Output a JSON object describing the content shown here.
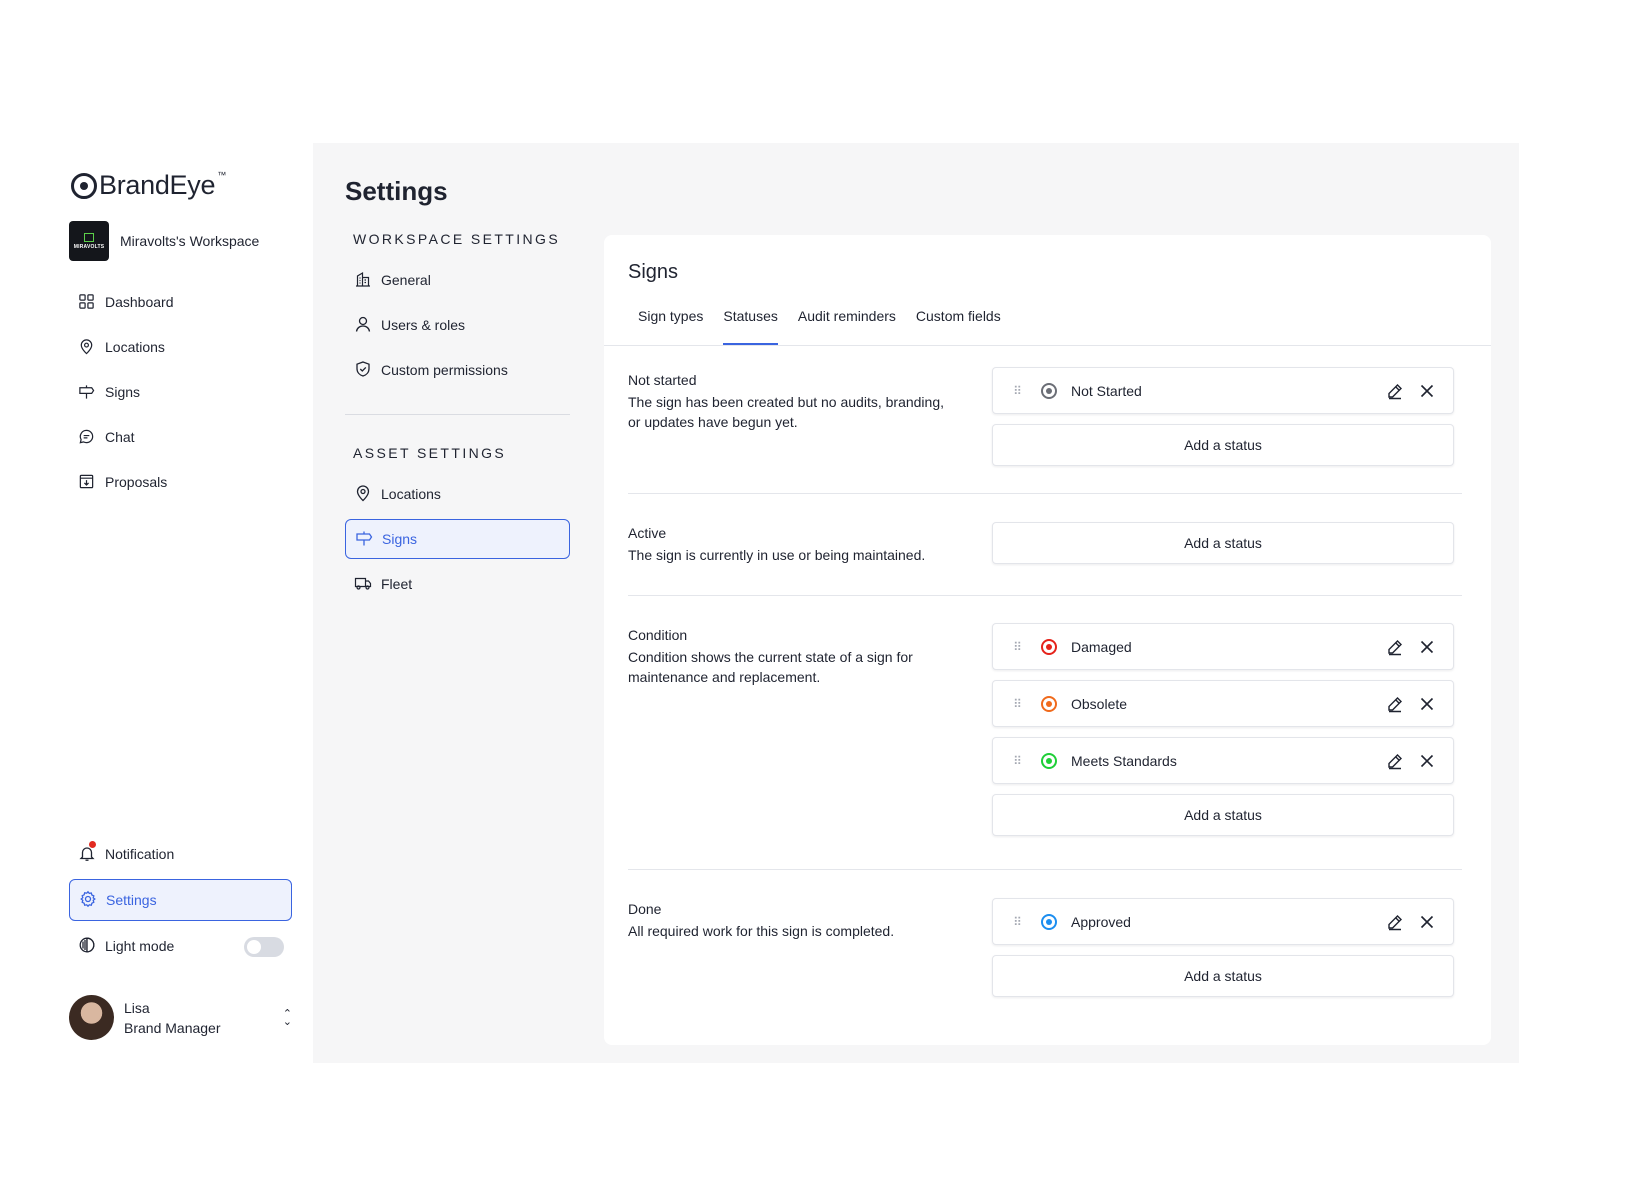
{
  "brand": {
    "name": "BrandEye",
    "tm": "™"
  },
  "workspace": {
    "logo_text": "MIRAVOLTS",
    "name": "Miravolts's Workspace"
  },
  "nav": [
    {
      "label": "Dashboard",
      "icon": "grid-icon"
    },
    {
      "label": "Locations",
      "icon": "pin-icon"
    },
    {
      "label": "Signs",
      "icon": "signpost-icon"
    },
    {
      "label": "Chat",
      "icon": "chat-icon"
    },
    {
      "label": "Proposals",
      "icon": "download-box-icon"
    }
  ],
  "bottom": {
    "notification": "Notification",
    "settings": "Settings",
    "light_mode": "Light mode",
    "light_mode_on": false
  },
  "user": {
    "name": "Lisa",
    "role": "Brand Manager"
  },
  "settings": {
    "title": "Settings",
    "workspace_heading": "WORKSPACE SETTINGS",
    "workspace_items": [
      {
        "label": "General",
        "icon": "building-icon"
      },
      {
        "label": "Users & roles",
        "icon": "user-icon"
      },
      {
        "label": "Custom permissions",
        "icon": "shield-check-icon"
      }
    ],
    "asset_heading": "ASSET SETTINGS",
    "asset_items": [
      {
        "label": "Locations",
        "icon": "pin-icon"
      },
      {
        "label": "Signs",
        "icon": "signpost-icon",
        "active": true
      },
      {
        "label": "Fleet",
        "icon": "truck-icon"
      }
    ]
  },
  "signs": {
    "title": "Signs",
    "tabs": [
      "Sign types",
      "Statuses",
      "Audit reminders",
      "Custom fields"
    ],
    "active_tab": "Statuses",
    "add_label": "Add a status",
    "groups": [
      {
        "title": "Not started",
        "desc": "The sign has been created but no audits, branding, or updates have begun yet.",
        "statuses": [
          {
            "label": "Not Started",
            "color": "#6b6e76"
          }
        ]
      },
      {
        "title": "Active",
        "desc": "The sign is currently in use or being maintained.",
        "statuses": []
      },
      {
        "title": "Condition",
        "desc": "Condition shows the current state of a sign for maintenance and replacement.",
        "statuses": [
          {
            "label": "Damaged",
            "color": "#e5231b"
          },
          {
            "label": "Obsolete",
            "color": "#f06a1c"
          },
          {
            "label": "Meets Standards",
            "color": "#1fcf38"
          }
        ]
      },
      {
        "title": "Done",
        "desc": "All required work for this sign is completed.",
        "statuses": [
          {
            "label": "Approved",
            "color": "#1c8ef0"
          }
        ]
      }
    ]
  },
  "colors": {
    "accent": "#3a64e0",
    "notification_dot": "#e22a20"
  }
}
